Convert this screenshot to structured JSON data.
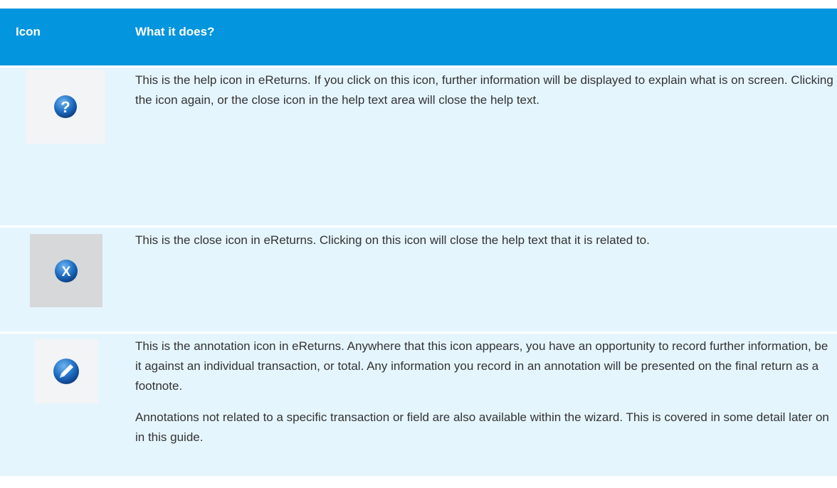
{
  "header": {
    "icon_col": "Icon",
    "desc_col": "What it does?"
  },
  "rows": [
    {
      "icon": "help-icon",
      "text": "This is the help icon in eReturns. If you click on this icon, further information will be displayed to explain what is on screen. Clicking the icon again, or the close icon in the help text area will close the help text."
    },
    {
      "icon": "close-icon",
      "text": "This is the close icon in eReturns. Clicking on this icon will close the help text that it is related to."
    },
    {
      "icon": "annotation-icon",
      "text": "This is the annotation icon in eReturns. Anywhere that this icon appears, you have an opportunity to record further information, be it against an individual transaction, or total. Any information you record in an annotation will be presented on the final return as a footnote.",
      "text2": "Annotations not related to a specific transaction or field are also available within the wizard. This is covered in some detail later on in this guide."
    }
  ],
  "colors": {
    "header_bg": "#0395dd",
    "row_bg": "#e5f5fe",
    "icon_blue": "#1a63b4"
  }
}
